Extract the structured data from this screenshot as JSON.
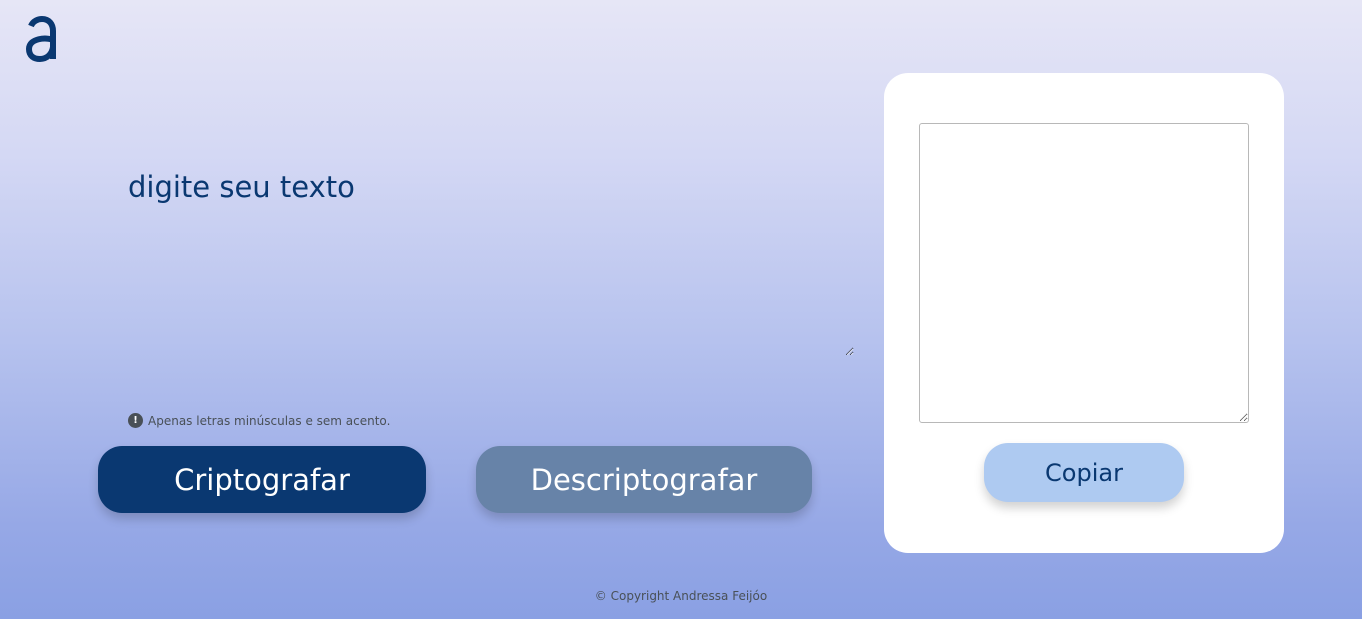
{
  "logo": {
    "icon": "alura-logo-icon",
    "color": "#0a3871"
  },
  "input": {
    "placeholder": "digite seu texto",
    "value": ""
  },
  "hint": {
    "icon": "exclamation-circle-icon",
    "icon_glyph": "!",
    "text": "Apenas letras minúsculas e sem acento."
  },
  "buttons": {
    "encrypt_label": "Criptografar",
    "decrypt_label": "Descriptografar",
    "copy_label": "Copiar"
  },
  "output": {
    "value": ""
  },
  "footer": {
    "text": "© Copyright Andressa Feijóo"
  },
  "colors": {
    "primary": "#0a3871",
    "secondary": "#6783a8",
    "copy_button": "#aecaf1",
    "panel": "#ffffff"
  }
}
